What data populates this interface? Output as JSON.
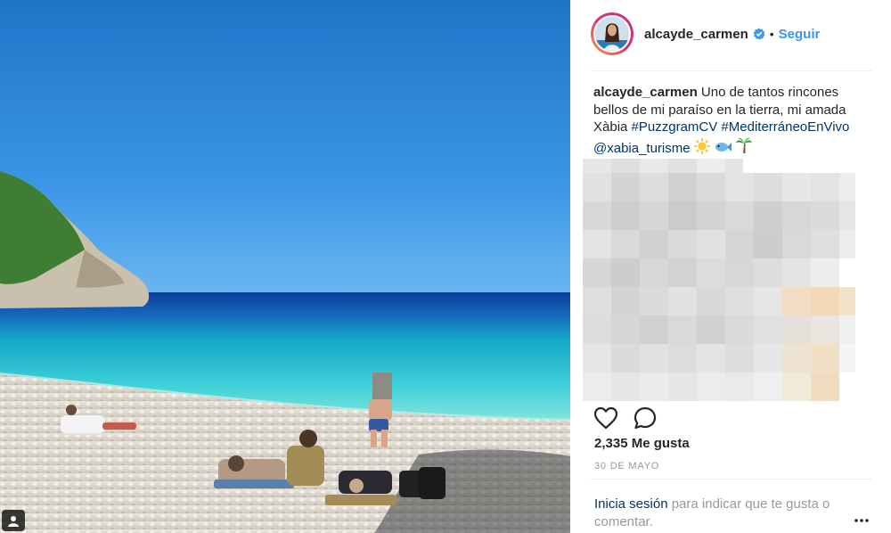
{
  "post": {
    "username": "alcayde_carmen",
    "separator": "•",
    "follow_label": "Seguir",
    "caption": {
      "username": "alcayde_carmen",
      "text": " Uno de tantos rincones bellos de mi paraíso en la tierra, mi amada Xàbia ",
      "hashtag1": "#PuzzgramCV",
      "hashtag2": "#MediterráneoEnVivo",
      "mention": "@xabia_turisme",
      "emojis": [
        "sun-emoji",
        "fish-emoji",
        "palm-tree-emoji"
      ]
    },
    "likes": "2,335 Me gusta",
    "date": "30 DE MAYO",
    "login": {
      "link": "Inicia sesión",
      "rest": " para indicar que te gusta o comentar."
    },
    "icons": {
      "like": "heart-icon",
      "comment": "comment-icon",
      "more": "more-options-icon",
      "verified": "verified-badge-icon",
      "user_tag": "user-tag-icon"
    }
  },
  "colors": {
    "link_blue": "#3897f0",
    "hashtag_navy": "#003569",
    "muted_gray": "#999999",
    "text": "#262626"
  }
}
